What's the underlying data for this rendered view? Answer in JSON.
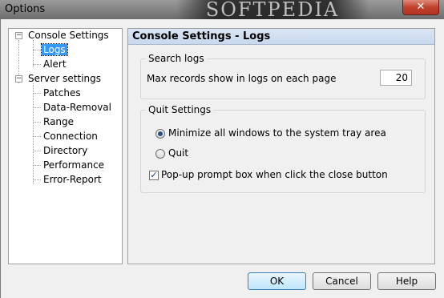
{
  "window": {
    "title": "Options",
    "watermark": "SOFTPEDIA",
    "close_glyph": "✕"
  },
  "tree": {
    "console_settings": "Console Settings",
    "logs": "Logs",
    "alert": "Alert",
    "server_settings": "Server settings",
    "children": [
      "Patches",
      "Data-Removal",
      "Range",
      "Connection",
      "Directory",
      "Performance",
      "Error-Report"
    ],
    "expander_glyph": "−"
  },
  "panel": {
    "header": "Console Settings - Logs",
    "search_logs": {
      "label": "Search logs",
      "max_records_label": "Max records show in logs on each page",
      "max_records_value": "20"
    },
    "quit_settings": {
      "label": "Quit Settings",
      "minimize_label": "Minimize all windows to the system tray area",
      "quit_label": "Quit",
      "popup_label": "Pop-up prompt box when click the close button",
      "minimize_checked": true,
      "popup_checked": true,
      "check_glyph": "✓"
    }
  },
  "buttons": {
    "ok": "OK",
    "cancel": "Cancel",
    "help": "Help"
  }
}
